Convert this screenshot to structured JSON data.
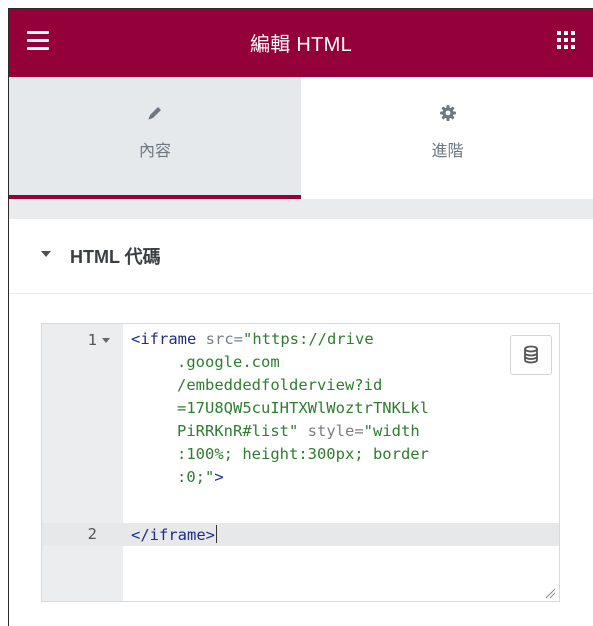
{
  "header": {
    "title": "編輯 HTML",
    "menu_icon": "hamburger-menu-icon",
    "apps_icon": "grid-apps-icon",
    "color": "#93003a"
  },
  "tabs": [
    {
      "label": "內容",
      "icon": "pencil-icon",
      "active": true
    },
    {
      "label": "進階",
      "icon": "gear-icon",
      "active": false
    }
  ],
  "section": {
    "title": "HTML 代碼",
    "collapse_icon": "caret-down-icon"
  },
  "editor": {
    "line_numbers": [
      "1",
      "2"
    ],
    "lines": [
      {
        "tag_open": "<iframe",
        "attr1": " src=",
        "val1": "\"https://drive"
      },
      {
        "text": ".google.com"
      },
      {
        "text": "/embeddedfolderview?id"
      },
      {
        "text": "=17U8QW5cuIHTXWlWoztrTNKLkl"
      },
      {
        "text": "PiRRKnR#list\"",
        "attr2": " style=",
        "val2": "\"width"
      },
      {
        "text": ":100%; height:300px; border"
      },
      {
        "text": ":0;\"",
        "tag_close": ">"
      },
      {
        "text": "</iframe>"
      }
    ],
    "db_icon": "database-icon",
    "resize_icon": "resize-handle-icon"
  }
}
